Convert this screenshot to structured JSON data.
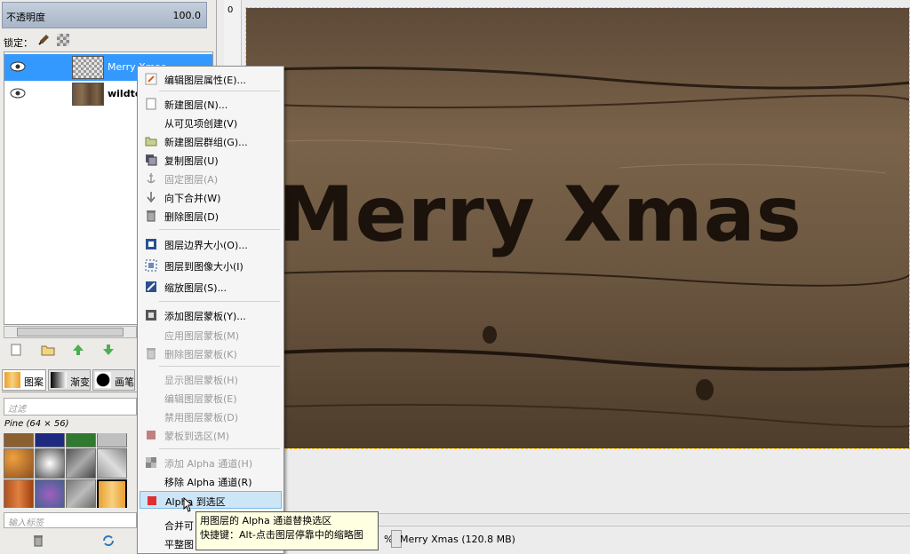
{
  "dock": {
    "opacity_label": "不透明度",
    "opacity_value": "100.0",
    "lock_label": "锁定：",
    "layers": [
      {
        "name": "Merry Xmas",
        "selected": true
      },
      {
        "name": "wildte",
        "selected": false
      }
    ],
    "brush_tabs": [
      "图案",
      "渐变",
      "画笔"
    ],
    "filter_placeholder": "过滤",
    "pattern_name": "Pine (64 × 56)",
    "tag_placeholder": "输入标签"
  },
  "canvas": {
    "ruler_zero": "0",
    "artwork_text": "Merry Xmas",
    "zoom_suffix": "%",
    "status_text": "Merry Xmas (120.8 MB)"
  },
  "menu": {
    "items": [
      {
        "label": "编辑图层属性(E)...",
        "icon": "edit-icon",
        "disabled": false
      },
      {
        "label": "新建图层(N)...",
        "icon": "new-page-icon",
        "disabled": false
      },
      {
        "label": "从可见项创建(V)",
        "icon": "",
        "disabled": false
      },
      {
        "label": "新建图层群组(G)...",
        "icon": "folder-icon",
        "disabled": false
      },
      {
        "label": "复制图层(U)",
        "icon": "duplicate-icon",
        "disabled": false
      },
      {
        "label": "固定图层(A)",
        "icon": "anchor-icon",
        "disabled": true
      },
      {
        "label": "向下合并(W)",
        "icon": "merge-down-icon",
        "disabled": false
      },
      {
        "label": "删除图层(D)",
        "icon": "trash-icon",
        "disabled": false
      },
      {
        "label": "图层边界大小(O)...",
        "icon": "boundary-icon",
        "disabled": false
      },
      {
        "label": "图层到图像大小(I)",
        "icon": "fit-icon",
        "disabled": false
      },
      {
        "label": "缩放图层(S)...",
        "icon": "scale-icon",
        "disabled": false
      },
      {
        "label": "添加图层蒙板(Y)...",
        "icon": "mask-icon",
        "disabled": false
      },
      {
        "label": "应用图层蒙板(M)",
        "icon": "",
        "disabled": true
      },
      {
        "label": "删除图层蒙板(K)",
        "icon": "trash-icon",
        "disabled": true
      },
      {
        "label": "显示图层蒙板(H)",
        "icon": "",
        "disabled": true
      },
      {
        "label": "编辑图层蒙板(E)",
        "icon": "",
        "disabled": true
      },
      {
        "label": "禁用图层蒙板(D)",
        "icon": "",
        "disabled": true
      },
      {
        "label": "蒙板到选区(M)",
        "icon": "mask-selection-icon",
        "disabled": true
      },
      {
        "label": "添加 Alpha 通道(H)",
        "icon": "alpha-add-icon",
        "disabled": true
      },
      {
        "label": "移除 Alpha 通道(R)",
        "icon": "",
        "disabled": false
      },
      {
        "label": "Alpha 到选区",
        "icon": "alpha-selection-icon",
        "disabled": false
      },
      {
        "label": "合并可",
        "icon": "",
        "disabled": false
      },
      {
        "label": "平整图",
        "icon": "",
        "disabled": false
      }
    ]
  },
  "tooltip": {
    "line1": "用图层的 Alpha 通道替换选区",
    "line2": "快捷键：Alt-点击图层停靠中的缩略图"
  },
  "colors": {
    "selection_blue": "#3399ff",
    "wood_dark": "#4a3a2a",
    "menu_hover": "#cde6f7"
  }
}
